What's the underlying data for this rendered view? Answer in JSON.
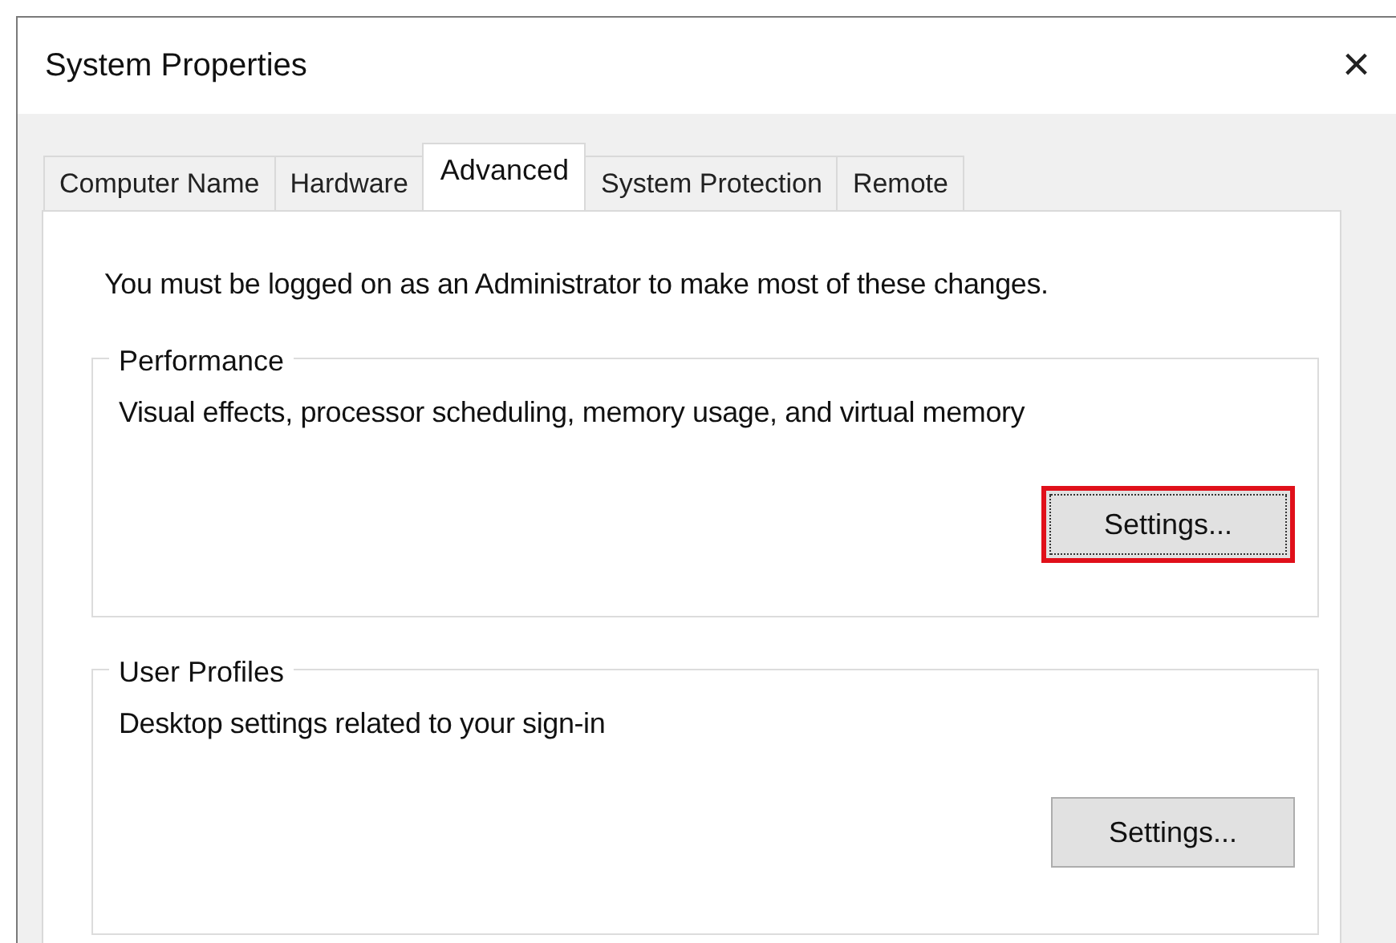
{
  "window": {
    "title": "System Properties",
    "close": "×"
  },
  "tabs": [
    {
      "label": "Computer Name",
      "selected": false
    },
    {
      "label": "Hardware",
      "selected": false
    },
    {
      "label": "Advanced",
      "selected": true
    },
    {
      "label": "System Protection",
      "selected": false
    },
    {
      "label": "Remote",
      "selected": false
    }
  ],
  "notice": "You must be logged on as an Administrator to make most of these changes.",
  "groups": [
    {
      "title": "Performance",
      "description": "Visual effects, processor scheduling, memory usage, and virtual memory",
      "button": {
        "label": "Settings...",
        "highlighted": true
      }
    },
    {
      "title": "User Profiles",
      "description": "Desktop settings related to your sign-in",
      "button": {
        "label": "Settings...",
        "highlighted": false
      }
    }
  ]
}
